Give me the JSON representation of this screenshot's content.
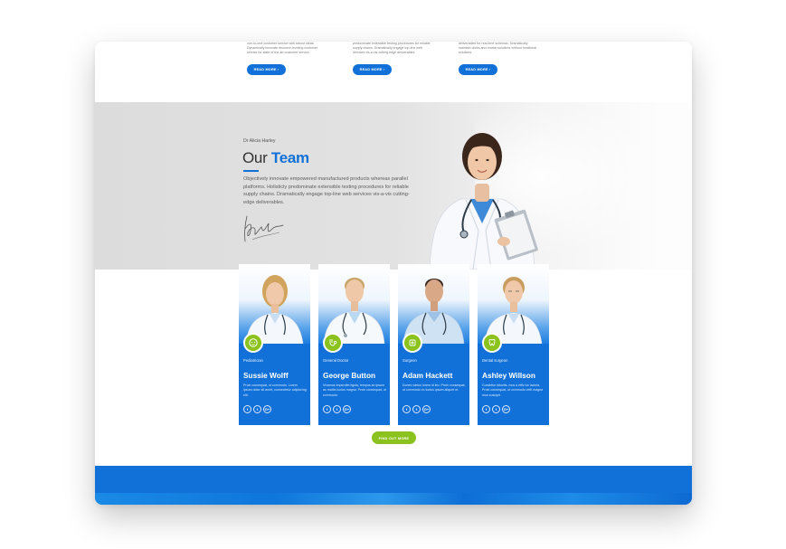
{
  "services": [
    {
      "text": "one-to-one customer service with robust ideas. Dynamically innovate resource-leveling customer service for state of the art customer service.",
      "button": "READ MORE  ›"
    },
    {
      "text": "predominate extensible testing procedures for reliable supply chains. Dramatically engage top-line web services vis-a-vis cutting-edge deliverables.",
      "button": "READ MORE  ›"
    },
    {
      "text": "deliverables for real-time schemas. Dramatically maintain clicks-and-mortar solutions without functional solutions.",
      "button": "READ MORE  ›"
    }
  ],
  "hero": {
    "eyebrow": "Dr Alicia Harley",
    "title_plain": "Our ",
    "title_bold": "Team",
    "text": "Objectively innovate empowered manufactured products whereas parallel platforms. Holisticly predominate extensible testing procedures for reliable supply chains. Dramatically engage top-line web services vis-a-vis cutting-edge deliverables."
  },
  "team": [
    {
      "role": "Pediatrician",
      "name": "Sussie Wolff",
      "bio": "Proin consequat, ut commodo. Lorem ipsum dolor sit amet, consectetur adipiscing elit.",
      "icon": "baby-icon",
      "social": [
        "f",
        "t",
        "G+"
      ]
    },
    {
      "role": "General Doctor",
      "name": "George Button",
      "bio": "Vivamus imperdiet ligula, tempus ac ipsum ac mattis luctus magna. Proin consequat, ut commodo.",
      "icon": "stethoscope-icon",
      "social": [
        "f",
        "t",
        "G+"
      ]
    },
    {
      "role": "Surgeon",
      "name": "Adam Hackett",
      "bio": "Donec varius lorem id leo. Proin consequat, ut commodo ex luctus ipsum aliquet ut.",
      "icon": "scalpel-icon",
      "social": [
        "f",
        "t",
        "G+"
      ]
    },
    {
      "role": "Dental surgeon",
      "name": "Ashley Willson",
      "bio": "Curabitur lobortis, mus a effic tur lacinia. Proin consequat, ut commodo velit magna mus suscipit.",
      "icon": "tooth-icon",
      "social": [
        "f",
        "t",
        "G+"
      ]
    }
  ],
  "cta": {
    "label": "FIND OUT MORE"
  },
  "colors": {
    "primary": "#1271d8",
    "accent": "#8cc21d",
    "hero_bg": "#dcdcdc"
  }
}
